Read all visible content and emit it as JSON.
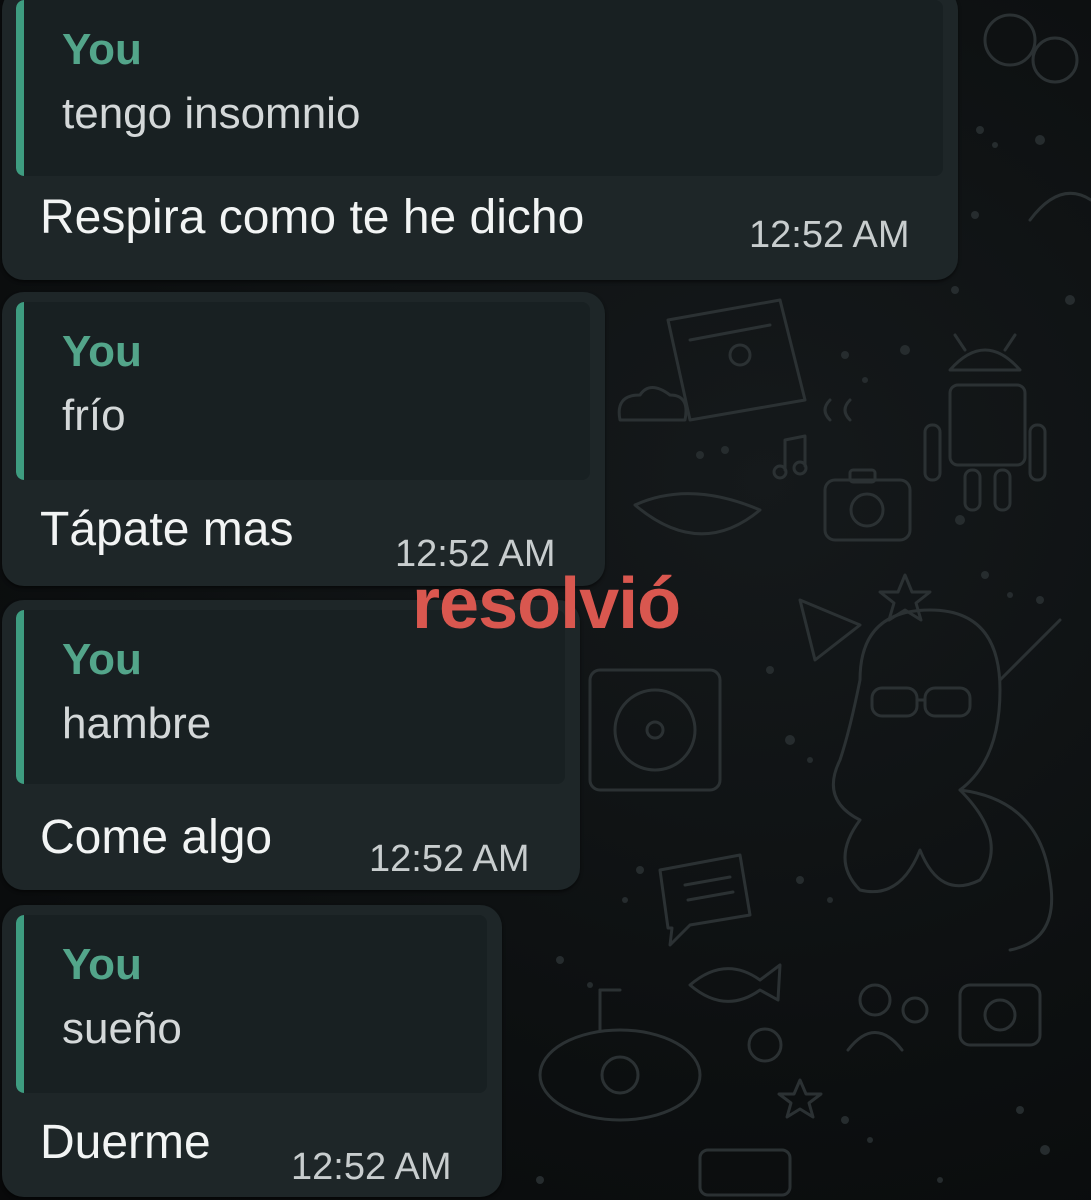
{
  "messages": [
    {
      "quote_author": "You",
      "quote_text": "tengo insomnio",
      "text": "Respira como te he dicho",
      "time": "12:52 AM"
    },
    {
      "quote_author": "You",
      "quote_text": "frío",
      "text": "Tápate mas",
      "time": "12:52 AM"
    },
    {
      "quote_author": "You",
      "quote_text": "hambre",
      "text": "Come algo",
      "time": "12:52 AM"
    },
    {
      "quote_author": "You",
      "quote_text": "sueño",
      "text": "Duerme",
      "time": "12:52 AM"
    }
  ],
  "overlay_caption": "resolvió",
  "colors": {
    "background": "#0b0d0e",
    "bubble": "#1e2628",
    "quote_bar": "#3e9c80",
    "quote_author": "#53a58a",
    "overlay": "#d9574f"
  }
}
